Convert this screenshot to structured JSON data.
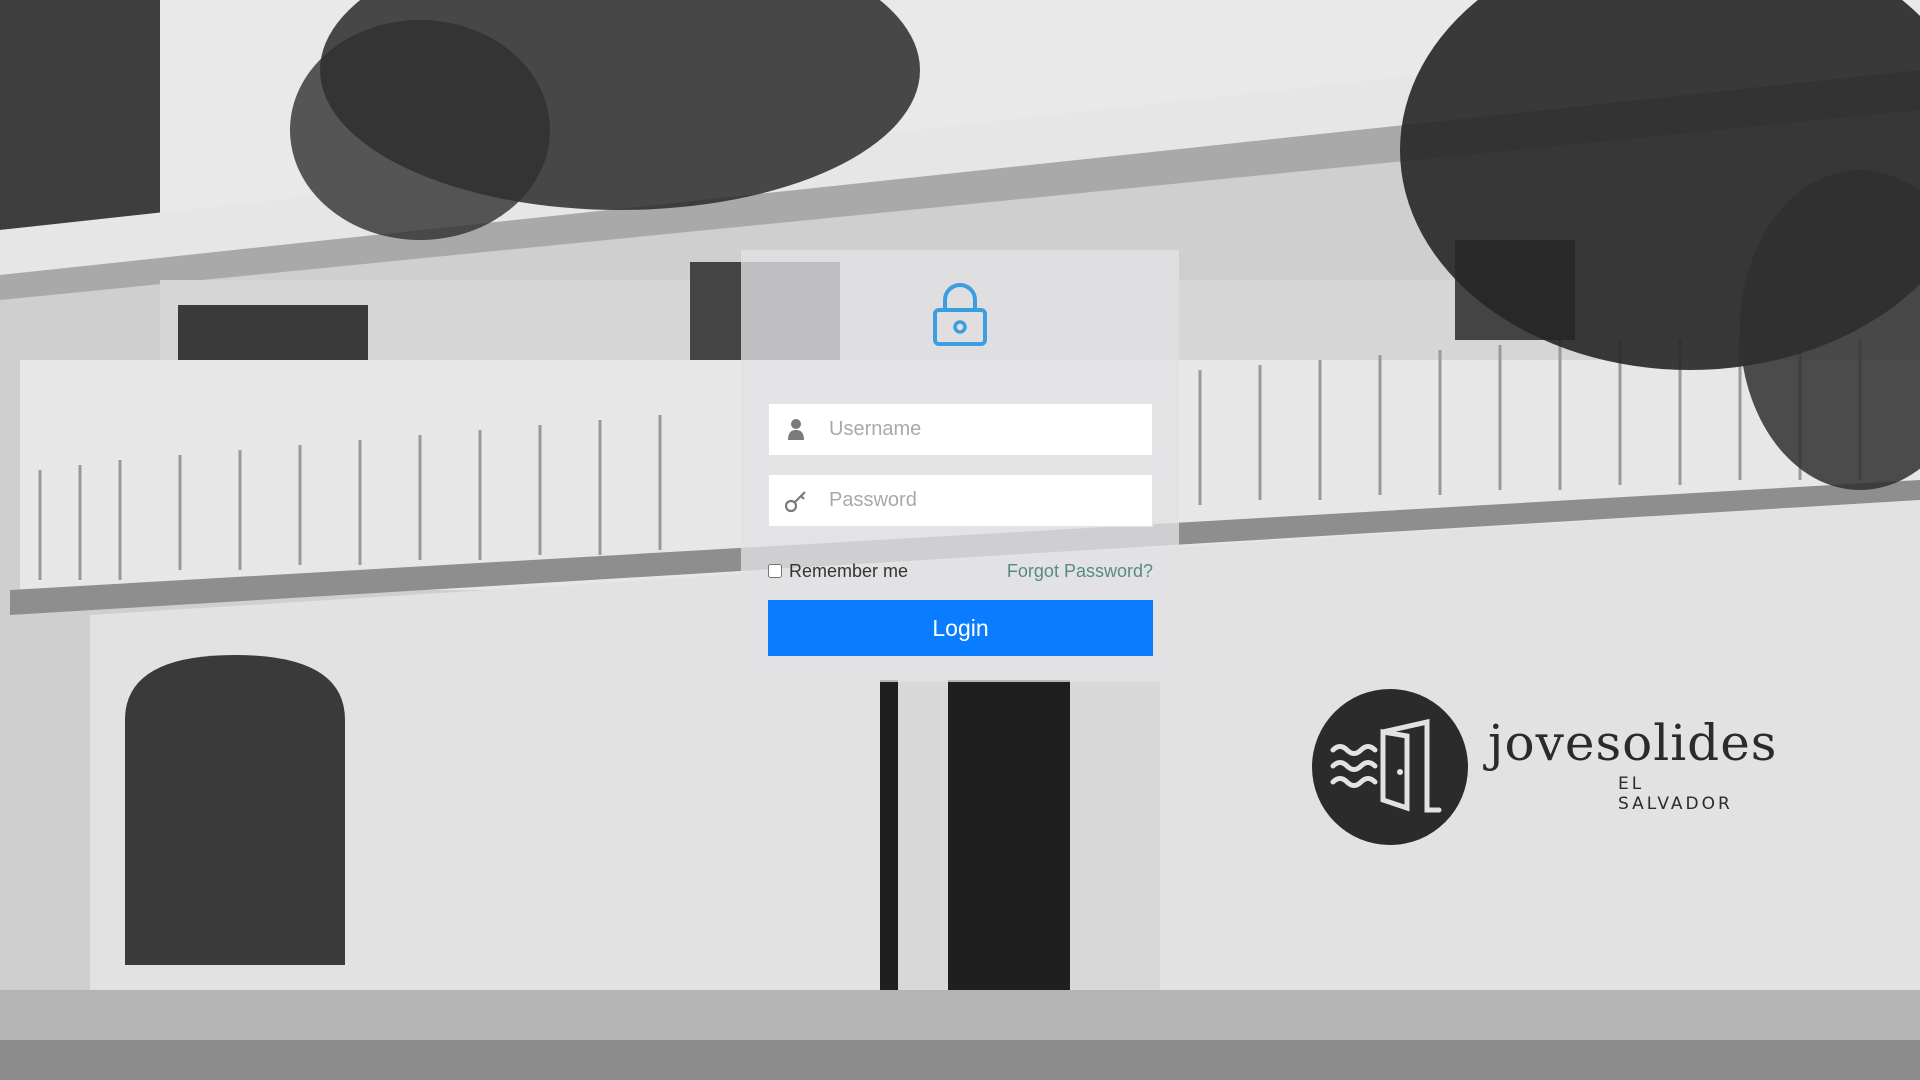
{
  "login": {
    "username_placeholder": "Username",
    "password_placeholder": "Password",
    "remember_label": "Remember me",
    "forgot_label": "Forgot Password?",
    "login_label": "Login"
  },
  "brand": {
    "name": "jovesolides",
    "subtitle": "EL SALVADOR"
  },
  "icons": {
    "lock": "lock-icon",
    "user": "user-icon",
    "key": "key-icon",
    "logo": "door-waves-logo-icon"
  },
  "colors": {
    "accent": "#0a7cff",
    "lock_icon": "#3a9ee0",
    "forgot_link": "#5a8a7e",
    "card_background": "#e1e1e6"
  }
}
